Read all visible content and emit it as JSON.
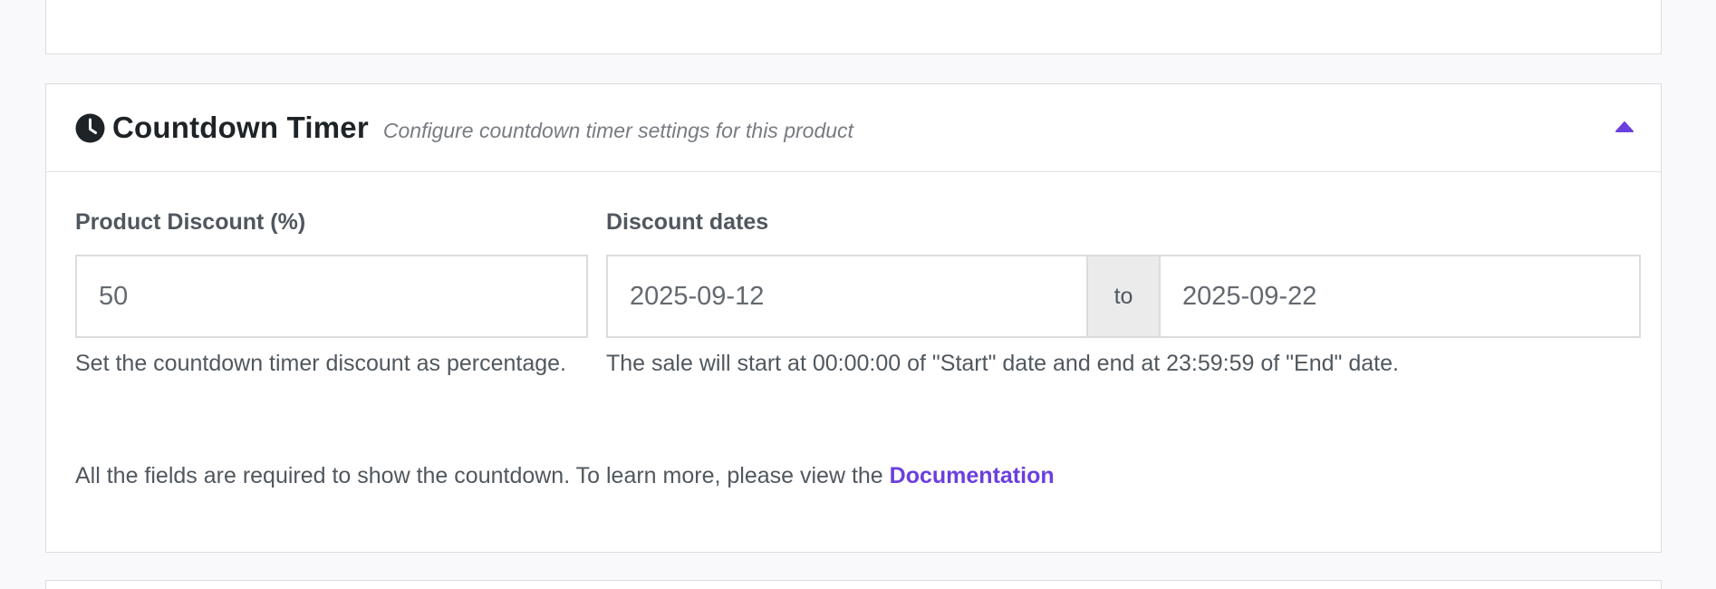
{
  "countdown": {
    "title": "Countdown Timer",
    "subtitle": "Configure countdown timer settings for this product",
    "icons": {
      "header": "clock-icon",
      "toggle": "caret-up-icon"
    },
    "colors": {
      "accent": "#6b3fde",
      "title": "#1d2327"
    },
    "discount": {
      "label": "Product Discount (%)",
      "value": "50",
      "help": "Set the countdown timer discount as percentage."
    },
    "dates": {
      "label": "Discount dates",
      "start": "2025-09-12",
      "separator": "to",
      "end": "2025-09-22",
      "help": "The sale will start at 00:00:00 of \"Start\" date and end at 23:59:59 of \"End\" date."
    },
    "notice": {
      "text": "All the fields are required to show the countdown. To learn more, please view the ",
      "link_label": "Documentation"
    }
  }
}
